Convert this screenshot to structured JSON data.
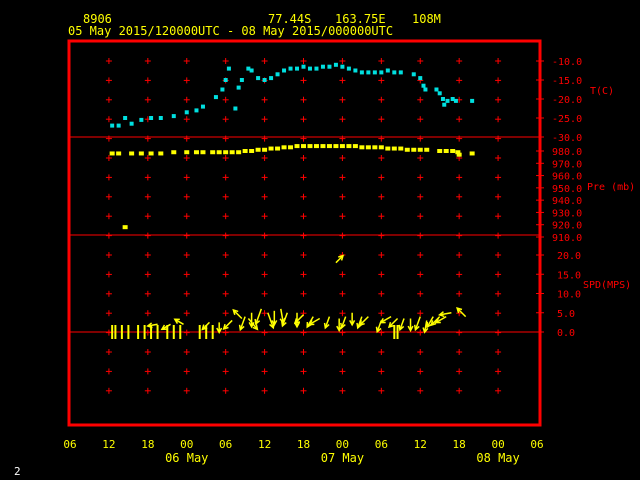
{
  "header": {
    "station": "8906",
    "lat": "77.44S",
    "lon": "163.75E",
    "elevation": "108M",
    "time_range": "05 May 2015/120000UTC - 08 May 2015/000000UTC"
  },
  "footer": {
    "page_number": "2"
  },
  "colors": {
    "frame": "#ff0000",
    "grid": "#ff0000",
    "labels": "#ff0000",
    "temperature": "#00e0e0",
    "pressure": "#ffff00",
    "wind": "#ffff00",
    "time_axis": "#ffff00"
  },
  "chart_data": {
    "type": "scatter",
    "x_axis": {
      "unit": "hours since 05 May 2015 06 UTC",
      "range": [
        0,
        72
      ],
      "tick_labels": [
        "06",
        "12",
        "18",
        "00",
        "06",
        "12",
        "18",
        "00",
        "06",
        "12",
        "18",
        "00",
        "06"
      ],
      "date_labels": [
        {
          "label": "06 May",
          "hour": 18
        },
        {
          "label": "07 May",
          "hour": 42
        },
        {
          "label": "08 May",
          "hour": 66
        }
      ]
    },
    "panels": [
      {
        "name": "temperature",
        "label": "T(C)",
        "range": [
          -30,
          -5
        ],
        "tick_labels": [
          "-10.0",
          "-15.0",
          "-20.0",
          "-25.0",
          "-30.0"
        ],
        "tick_values": [
          -10,
          -15,
          -20,
          -25,
          -30
        ],
        "points": [
          [
            6.5,
            -27
          ],
          [
            7.5,
            -27
          ],
          [
            8.5,
            -25
          ],
          [
            9.5,
            -26.5
          ],
          [
            11,
            -25.5
          ],
          [
            12.5,
            -25
          ],
          [
            14,
            -25
          ],
          [
            16,
            -24.5
          ],
          [
            18,
            -23.5
          ],
          [
            19.5,
            -23
          ],
          [
            20.5,
            -22
          ],
          [
            22.5,
            -19.5
          ],
          [
            23.5,
            -17.5
          ],
          [
            24,
            -15
          ],
          [
            24.5,
            -12
          ],
          [
            25.5,
            -22.5
          ],
          [
            26,
            -17
          ],
          [
            26.5,
            -15
          ],
          [
            27.5,
            -12
          ],
          [
            28,
            -12.5
          ],
          [
            29,
            -14.5
          ],
          [
            30,
            -15
          ],
          [
            31,
            -14.5
          ],
          [
            32,
            -13.5
          ],
          [
            33,
            -12.5
          ],
          [
            34,
            -12
          ],
          [
            35,
            -12
          ],
          [
            36,
            -11.5
          ],
          [
            37,
            -12
          ],
          [
            38,
            -12
          ],
          [
            39,
            -11.5
          ],
          [
            40,
            -11.5
          ],
          [
            41,
            -11
          ],
          [
            42,
            -11.5
          ],
          [
            43,
            -12
          ],
          [
            44,
            -12.5
          ],
          [
            45,
            -13
          ],
          [
            46,
            -13
          ],
          [
            47,
            -13
          ],
          [
            48,
            -13
          ],
          [
            49,
            -12.5
          ],
          [
            50,
            -13
          ],
          [
            51,
            -13
          ],
          [
            53,
            -13.5
          ],
          [
            54,
            -14.5
          ],
          [
            54.5,
            -16.5
          ],
          [
            54.8,
            -17.5
          ],
          [
            56.5,
            -17.5
          ],
          [
            57,
            -18.5
          ],
          [
            57.5,
            -20
          ],
          [
            57.7,
            -21.5
          ],
          [
            58.2,
            -20.5
          ],
          [
            59,
            -20
          ],
          [
            59.5,
            -20.5
          ],
          [
            62,
            -20.5
          ]
        ]
      },
      {
        "name": "pressure",
        "label": "Pre (mb)",
        "range": [
          910,
          990
        ],
        "tick_labels": [
          "980.0",
          "970.0",
          "960.0",
          "950.0",
          "940.0",
          "930.0",
          "920.0",
          "910.0"
        ],
        "tick_values": [
          980,
          970,
          960,
          950,
          940,
          930,
          920,
          910
        ],
        "points": [
          [
            6.5,
            978
          ],
          [
            7.5,
            978
          ],
          [
            8.5,
            918
          ],
          [
            9.5,
            978
          ],
          [
            11,
            978
          ],
          [
            12.5,
            978
          ],
          [
            14,
            978
          ],
          [
            16,
            979
          ],
          [
            18,
            979
          ],
          [
            19.5,
            979
          ],
          [
            20.5,
            979
          ],
          [
            22,
            979
          ],
          [
            23,
            979
          ],
          [
            24,
            979
          ],
          [
            25,
            979
          ],
          [
            26,
            979
          ],
          [
            27,
            980
          ],
          [
            28,
            980
          ],
          [
            29,
            981
          ],
          [
            30,
            981
          ],
          [
            31,
            982
          ],
          [
            32,
            982
          ],
          [
            33,
            983
          ],
          [
            34,
            983
          ],
          [
            35,
            984
          ],
          [
            36,
            984
          ],
          [
            37,
            984
          ],
          [
            38,
            984
          ],
          [
            39,
            984
          ],
          [
            40,
            984
          ],
          [
            41,
            984
          ],
          [
            42,
            984
          ],
          [
            43,
            984
          ],
          [
            44,
            984
          ],
          [
            45,
            983
          ],
          [
            46,
            983
          ],
          [
            47,
            983
          ],
          [
            48,
            983
          ],
          [
            49,
            982
          ],
          [
            50,
            982
          ],
          [
            51,
            982
          ],
          [
            52,
            981
          ],
          [
            53,
            981
          ],
          [
            54,
            981
          ],
          [
            55,
            981
          ],
          [
            57,
            980
          ],
          [
            58,
            980
          ],
          [
            59,
            980
          ],
          [
            59.8,
            979
          ],
          [
            60,
            977
          ],
          [
            62,
            978
          ]
        ]
      },
      {
        "name": "wind",
        "label": "SPD(MPS)",
        "range": [
          0,
          25
        ],
        "tick_labels": [
          "20.0",
          "15.0",
          "10.0",
          "5.0",
          "0.0"
        ],
        "tick_values": [
          20,
          15,
          10,
          5,
          0
        ],
        "arrows": [
          [
            21.5,
            2.5,
            225,
            2
          ],
          [
            23,
            2.5,
            180,
            2
          ],
          [
            25,
            3,
            225,
            3
          ],
          [
            26.5,
            3.5,
            315,
            3
          ],
          [
            27,
            4,
            200,
            4
          ],
          [
            27.5,
            3.5,
            140,
            4
          ],
          [
            28,
            5,
            180,
            4
          ],
          [
            29.5,
            6,
            200,
            5
          ],
          [
            30.5,
            5,
            160,
            5
          ],
          [
            31.5,
            5.5,
            180,
            4
          ],
          [
            32.5,
            6,
            170,
            4
          ],
          [
            33.5,
            5,
            200,
            4
          ],
          [
            35,
            5,
            180,
            4
          ],
          [
            36,
            4.5,
            225,
            3
          ],
          [
            37.5,
            4,
            210,
            3
          ],
          [
            38.5,
            3.5,
            240,
            3
          ],
          [
            40,
            4,
            200,
            3
          ],
          [
            41,
            18,
            45,
            2
          ],
          [
            41.5,
            3.5,
            180,
            3
          ],
          [
            42.5,
            4,
            200,
            3
          ],
          [
            43.5,
            5,
            180,
            3
          ],
          [
            45,
            4,
            200,
            3
          ],
          [
            46,
            4,
            225,
            3
          ],
          [
            48,
            3,
            200,
            3
          ],
          [
            49.5,
            4,
            240,
            3
          ],
          [
            50.5,
            3.5,
            225,
            3
          ],
          [
            51.5,
            3.5,
            200,
            3
          ],
          [
            52.5,
            3.5,
            180,
            3
          ],
          [
            54,
            4,
            200,
            4
          ],
          [
            55,
            3,
            190,
            3
          ],
          [
            56,
            4,
            210,
            3
          ],
          [
            57,
            4,
            225,
            3
          ],
          [
            58,
            4,
            240,
            3
          ],
          [
            58.8,
            5,
            260,
            3
          ],
          [
            61,
            4,
            315,
            3
          ]
        ],
        "calm_hours": [
          6.5,
          7,
          8,
          9,
          10.5,
          11.5,
          12.5,
          13.5,
          15,
          16,
          17,
          20,
          21,
          22,
          50,
          50.5
        ],
        "flag_hours": [
          [
            13.5,
            2,
            260,
            2
          ],
          [
            15.5,
            2,
            240,
            2
          ],
          [
            17.5,
            2,
            300,
            2
          ]
        ]
      }
    ]
  }
}
